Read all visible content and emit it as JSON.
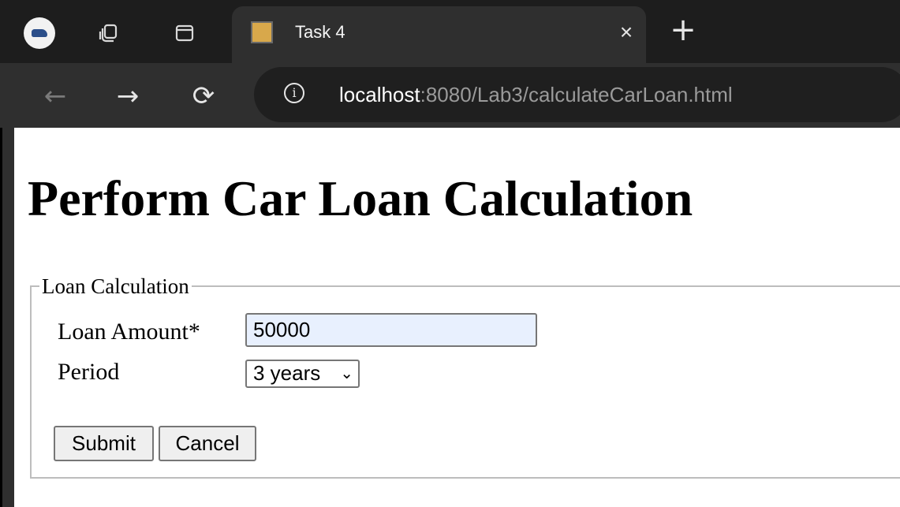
{
  "browser": {
    "tab_title": "Task 4",
    "tab_close": "×",
    "new_tab": "+",
    "url_host": "localhost",
    "url_rest": ":8080/Lab3/calculateCarLoan.html"
  },
  "page": {
    "heading": "Perform Car Loan Calculation",
    "fieldset_legend": "Loan Calculation",
    "loan_amount_label": "Loan Amount*",
    "loan_amount_value": "50000",
    "period_label": "Period",
    "period_selected": "3 years",
    "submit_label": "Submit",
    "cancel_label": "Cancel"
  },
  "icons": {
    "profile": "profile-avatar",
    "workspaces": "workspaces-icon",
    "tab_actions": "tab-actions-icon",
    "back": "back-arrow-icon",
    "forward": "forward-arrow-icon",
    "reload": "reload-icon",
    "site_info": "info-icon"
  },
  "colors": {
    "input_autofill_bg": "#e8f0fe",
    "browser_bg": "#1d1d1d",
    "toolbar_bg": "#2f2f2f"
  }
}
